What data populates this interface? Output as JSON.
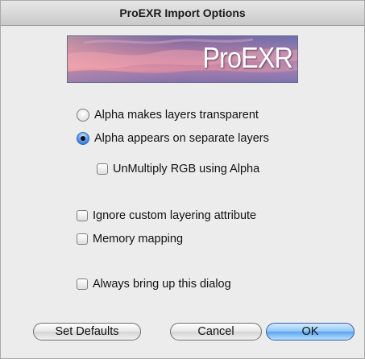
{
  "window": {
    "title": "ProEXR Import Options"
  },
  "banner": {
    "text": "ProEXR"
  },
  "options": {
    "alpha_transparent": {
      "label": "Alpha makes layers transparent",
      "checked": false
    },
    "alpha_separate": {
      "label": "Alpha appears on separate layers",
      "checked": true
    },
    "unmultiply": {
      "label": "UnMultiply RGB using Alpha",
      "checked": false
    },
    "ignore_custom": {
      "label": "Ignore custom layering attribute",
      "checked": false
    },
    "memory_mapping": {
      "label": "Memory mapping",
      "checked": false
    },
    "always_bring_up": {
      "label": "Always bring up this dialog",
      "checked": false
    }
  },
  "buttons": {
    "set_defaults": "Set Defaults",
    "cancel": "Cancel",
    "ok": "OK"
  },
  "colors": {
    "default_button": "#5aa3ee",
    "dialog_bg": "#ececec"
  }
}
